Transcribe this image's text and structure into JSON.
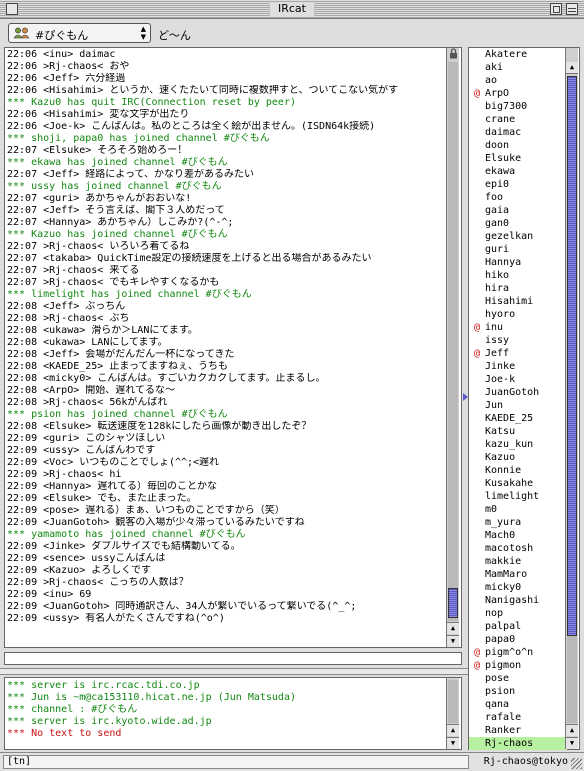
{
  "window": {
    "title": "IRcat"
  },
  "channel": {
    "name": "#ぴぐもん",
    "topic": "ど〜ん"
  },
  "log": [
    {
      "t": "22:06 <inu> daimac",
      "k": "msg"
    },
    {
      "t": "22:06 >Rj-chaos< おや",
      "k": "msg"
    },
    {
      "t": "22:06 <Jeff> 六分経過",
      "k": "msg"
    },
    {
      "t": "22:06 <Hisahimi> というか、速くたたいて同時に複数押すと、ついてこない気がす",
      "k": "msg"
    },
    {
      "t": "*** Kazu0 has quit IRC(Connection reset by peer)",
      "k": "sys"
    },
    {
      "t": "22:06 <Hisahimi> 変な文字が出たり",
      "k": "msg"
    },
    {
      "t": "22:06 <Joe-k> こんばんは。私のところは全く絵が出ません。(ISDN64k接続)",
      "k": "msg"
    },
    {
      "t": "*** shoji, papa0 has joined channel #ぴぐもん",
      "k": "sys"
    },
    {
      "t": "22:07 <Elsuke> そろそろ始めろー！",
      "k": "msg"
    },
    {
      "t": "*** ekawa has joined channel #ぴぐもん",
      "k": "sys"
    },
    {
      "t": "22:07 <Jeff> 経路によって、かなり差があるみたい",
      "k": "msg"
    },
    {
      "t": "*** ussy has joined channel #ぴぐもん",
      "k": "sys"
    },
    {
      "t": "22:07 <guri> あかちゃんがおおいな!",
      "k": "msg"
    },
    {
      "t": "22:07 <Jeff> そう言えば、閣下３人めだって",
      "k": "msg"
    },
    {
      "t": "22:07 <Hannya> あかちゃん）しこみか?(^-^;",
      "k": "msg"
    },
    {
      "t": "*** Kazuo has joined channel #ぴぐもん",
      "k": "sys"
    },
    {
      "t": "22:07 >Rj-chaos< いろいろ着てるね",
      "k": "msg"
    },
    {
      "t": "22:07 <takaba> QuickTime設定の接続速度を上げると出る場合があるみたい",
      "k": "msg"
    },
    {
      "t": "22:07 >Rj-chaos< 来てる",
      "k": "msg"
    },
    {
      "t": "22:07 >Rj-chaos< でもキレやすくなるかも",
      "k": "msg"
    },
    {
      "t": "*** limelight has joined channel #ぴぐもん",
      "k": "sys"
    },
    {
      "t": "22:08 <Jeff> ぶっちん",
      "k": "msg"
    },
    {
      "t": "22:08 >Rj-chaos< ぶち",
      "k": "msg"
    },
    {
      "t": "22:08 <ukawa> 滑らか＞LANにてます。",
      "k": "msg"
    },
    {
      "t": "22:08 <ukawa> LANにしてます。",
      "k": "msg"
    },
    {
      "t": "22:08 <Jeff> 会場がだんだん一杯になってきた",
      "k": "msg"
    },
    {
      "t": "22:08 <KAEDE_25> 止まってますねぇ、うちも",
      "k": "msg"
    },
    {
      "t": "22:08 <micky0> こんばんは。すごいカクカクしてます。止まるし。",
      "k": "msg"
    },
    {
      "t": "22:08 <ArpO> 開始、遅れてるな〜",
      "k": "msg"
    },
    {
      "t": "22:08 >Rj-chaos< 56kがんばれ",
      "k": "msg"
    },
    {
      "t": "*** psion has joined channel #ぴぐもん",
      "k": "sys"
    },
    {
      "t": "22:08 <Elsuke> 転送速度を128kにしたら画像が動き出したぞ？",
      "k": "msg"
    },
    {
      "t": "22:09 <guri> このシャツほしい",
      "k": "msg"
    },
    {
      "t": "22:09 <ussy> こんばんわです",
      "k": "msg"
    },
    {
      "t": "22:09 <Voc> いつものことでしょ(^^;<遅れ",
      "k": "msg"
    },
    {
      "t": "22:09 >Rj-chaos< hi",
      "k": "msg"
    },
    {
      "t": "22:09 <Hannya> 遅れてる）毎回のことかな",
      "k": "msg"
    },
    {
      "t": "22:09 <Elsuke> でも、また止まった。",
      "k": "msg"
    },
    {
      "t": "22:09 <pose> 遅れる）まぁ、いつものことですから（笑）",
      "k": "msg"
    },
    {
      "t": "22:09 <JuanGotoh> 観客の入場が少々滞っているみたいですね",
      "k": "msg"
    },
    {
      "t": "*** yamamoto has joined channel #ぴぐもん",
      "k": "sys"
    },
    {
      "t": "22:09 <Jinke> ダブルサイズでも結構動いてる。",
      "k": "msg"
    },
    {
      "t": "22:09 <sence> ussyこんばんは",
      "k": "msg"
    },
    {
      "t": "22:09 <Kazuo> よろしくです",
      "k": "msg"
    },
    {
      "t": "22:09 >Rj-chaos< こっちの人数は？",
      "k": "msg"
    },
    {
      "t": "22:09 <inu> 69",
      "k": "msg"
    },
    {
      "t": "22:09 <JuanGotoh> 同時通訳さん、34人が繋いでいるって繋いでる(^_^;",
      "k": "msg"
    },
    {
      "t": "22:09 <ussy> 有名人がたくさんですね(^o^)",
      "k": "msg"
    }
  ],
  "server_log": [
    {
      "t": "*** server is irc.rcac.tdi.co.jp",
      "k": "sys"
    },
    {
      "t": "*** Jun is ~m@ca153110.hicat.ne.jp (Jun Matsuda)",
      "k": "sys"
    },
    {
      "t": "*** channel : #ぴぐもん",
      "k": "sys"
    },
    {
      "t": "*** server is irc.kyoto.wide.ad.jp",
      "k": "sys"
    },
    {
      "t": "*** No text to send",
      "k": "err"
    }
  ],
  "nicks": [
    {
      "n": "Akatere",
      "op": false
    },
    {
      "n": "aki",
      "op": false
    },
    {
      "n": "ao",
      "op": false
    },
    {
      "n": "ArpO",
      "op": true
    },
    {
      "n": "big7300",
      "op": false
    },
    {
      "n": "crane",
      "op": false
    },
    {
      "n": "daimac",
      "op": false
    },
    {
      "n": "doon",
      "op": false
    },
    {
      "n": "Elsuke",
      "op": false
    },
    {
      "n": "ekawa",
      "op": false
    },
    {
      "n": "epi0",
      "op": false
    },
    {
      "n": "foo",
      "op": false
    },
    {
      "n": "gaia",
      "op": false
    },
    {
      "n": "gan0",
      "op": false
    },
    {
      "n": "gezelkan",
      "op": false
    },
    {
      "n": "guri",
      "op": false
    },
    {
      "n": "Hannya",
      "op": false
    },
    {
      "n": "hiko",
      "op": false
    },
    {
      "n": "hira",
      "op": false
    },
    {
      "n": "Hisahimi",
      "op": false
    },
    {
      "n": "hyoro",
      "op": false
    },
    {
      "n": "inu",
      "op": true
    },
    {
      "n": "issy",
      "op": false
    },
    {
      "n": "Jeff",
      "op": true
    },
    {
      "n": "Jinke",
      "op": false
    },
    {
      "n": "Joe-k",
      "op": false
    },
    {
      "n": "JuanGotoh",
      "op": false
    },
    {
      "n": "Jun",
      "op": false
    },
    {
      "n": "KAEDE_25",
      "op": false
    },
    {
      "n": "Katsu",
      "op": false
    },
    {
      "n": "kazu_kun",
      "op": false
    },
    {
      "n": "Kazuo",
      "op": false
    },
    {
      "n": "Konnie",
      "op": false
    },
    {
      "n": "Kusakahe",
      "op": false
    },
    {
      "n": "limelight",
      "op": false
    },
    {
      "n": "m0",
      "op": false
    },
    {
      "n": "m_yura",
      "op": false
    },
    {
      "n": "Mach0",
      "op": false
    },
    {
      "n": "macotosh",
      "op": false
    },
    {
      "n": "makkie",
      "op": false
    },
    {
      "n": "MamMaro",
      "op": false
    },
    {
      "n": "micky0",
      "op": false
    },
    {
      "n": "Nanigashi",
      "op": false
    },
    {
      "n": "nop",
      "op": false
    },
    {
      "n": "palpal",
      "op": false
    },
    {
      "n": "papa0",
      "op": false
    },
    {
      "n": "pigm^o^n",
      "op": true
    },
    {
      "n": "pigmon",
      "op": true
    },
    {
      "n": "pose",
      "op": false
    },
    {
      "n": "psion",
      "op": false
    },
    {
      "n": "qana",
      "op": false
    },
    {
      "n": "rafale",
      "op": false
    },
    {
      "n": "Ranker",
      "op": false
    },
    {
      "n": "Rj-chaos",
      "op": false,
      "selected": true
    }
  ],
  "op_mark": "@",
  "input": {
    "value": ""
  },
  "status": {
    "mode": "[tn]",
    "user": "Rj-chaos@tokyo"
  },
  "colors": {
    "system": "#118811",
    "error": "#cc1111",
    "selected_nick": "#b7f0a0",
    "scroll_thumb": "#6f6fd0"
  },
  "icons": [
    "close-box-icon",
    "zoom-box-icon",
    "collapse-box-icon",
    "channel-people-icon",
    "lock-icon",
    "grow-box-icon"
  ]
}
